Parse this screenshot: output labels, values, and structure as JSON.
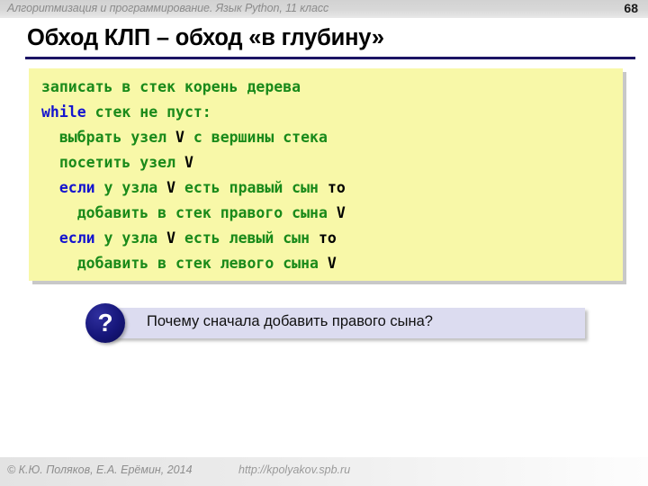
{
  "header": {
    "course_title": "Алгоритмизация и программирование. Язык Python, 11 класс",
    "page_number": "68"
  },
  "slide": {
    "title": "Обход КЛП – обход «в глубину»"
  },
  "code": {
    "language_style": "pseudocode-russian",
    "background_color": "#f8f8a8",
    "text_color": "#1a8a1a",
    "keyword_color": "#1414cf",
    "variable_color": "#000000",
    "lines": [
      {
        "indent": 0,
        "tokens": [
          {
            "t": "записать в стек корень дерева",
            "k": "plain"
          }
        ]
      },
      {
        "indent": 0,
        "tokens": [
          {
            "t": "while",
            "k": "keyword"
          },
          {
            "t": " стек не пуст:",
            "k": "plain"
          }
        ]
      },
      {
        "indent": 1,
        "tokens": [
          {
            "t": "выбрать узел ",
            "k": "plain"
          },
          {
            "t": "V",
            "k": "var"
          },
          {
            "t": " с вершины стека",
            "k": "plain"
          }
        ]
      },
      {
        "indent": 1,
        "tokens": [
          {
            "t": "посетить узел ",
            "k": "plain"
          },
          {
            "t": "V",
            "k": "var"
          }
        ]
      },
      {
        "indent": 1,
        "tokens": [
          {
            "t": "если",
            "k": "keyword"
          },
          {
            "t": " у узла ",
            "k": "plain"
          },
          {
            "t": "V",
            "k": "var"
          },
          {
            "t": " есть правый сын ",
            "k": "plain"
          },
          {
            "t": "то",
            "k": "var"
          }
        ]
      },
      {
        "indent": 2,
        "tokens": [
          {
            "t": "добавить в стек правого сына ",
            "k": "plain"
          },
          {
            "t": "V",
            "k": "var"
          }
        ]
      },
      {
        "indent": 1,
        "tokens": [
          {
            "t": "если",
            "k": "keyword"
          },
          {
            "t": " у узла ",
            "k": "plain"
          },
          {
            "t": "V",
            "k": "var"
          },
          {
            "t": " есть левый сын ",
            "k": "plain"
          },
          {
            "t": "то",
            "k": "var"
          }
        ]
      },
      {
        "indent": 2,
        "tokens": [
          {
            "t": "добавить в стек левого сына ",
            "k": "plain"
          },
          {
            "t": "V",
            "k": "var"
          }
        ]
      }
    ]
  },
  "callout": {
    "badge_glyph": "?",
    "badge_icon_name": "question-mark-icon",
    "text": "Почему сначала добавить правого сына?",
    "background_color": "#dcdcf0",
    "badge_color": "#16167a"
  },
  "footer": {
    "copyright": "© К.Ю. Поляков, Е.А. Ерёмин, 2014",
    "url": "http://kpolyakov.spb.ru"
  }
}
